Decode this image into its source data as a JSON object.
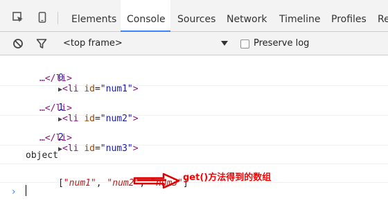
{
  "toolbar": {
    "tabs": [
      {
        "label": "Elements"
      },
      {
        "label": "Console",
        "active": true
      },
      {
        "label": "Sources"
      },
      {
        "label": "Network"
      },
      {
        "label": "Timeline"
      },
      {
        "label": "Profiles"
      },
      {
        "label": "Re"
      }
    ],
    "frame": "<top frame>",
    "preserve_log": "Preserve log",
    "preserve_log_checked": false
  },
  "console": {
    "entries": [
      {
        "index": "0",
        "tag_open": "<li",
        "attr": "id",
        "value": "\"num1\"",
        "tag_close": ">",
        "ellipsis": "…</li>"
      },
      {
        "index": "1",
        "tag_open": "<li",
        "attr": "id",
        "value": "\"num2\"",
        "tag_close": ">",
        "ellipsis": "…</li>"
      },
      {
        "index": "2",
        "tag_open": "<li",
        "attr": "id",
        "value": "\"num3\"",
        "tag_close": ">",
        "ellipsis": "…</li>"
      }
    ],
    "object_line": "object",
    "array": {
      "open": "[",
      "items": [
        "\"num1\"",
        "\"num2\"",
        "\"num3\""
      ],
      "separator": ", ",
      "close": "]"
    },
    "prompt_symbol": "›"
  },
  "annotation": {
    "text": "get()方法得到的数组",
    "color": "#ff0000"
  },
  "colors": {
    "accent": "#3e82f7",
    "tag": "#881280",
    "attr": "#994500",
    "value": "#1a1aa6",
    "string": "#c41a16"
  }
}
